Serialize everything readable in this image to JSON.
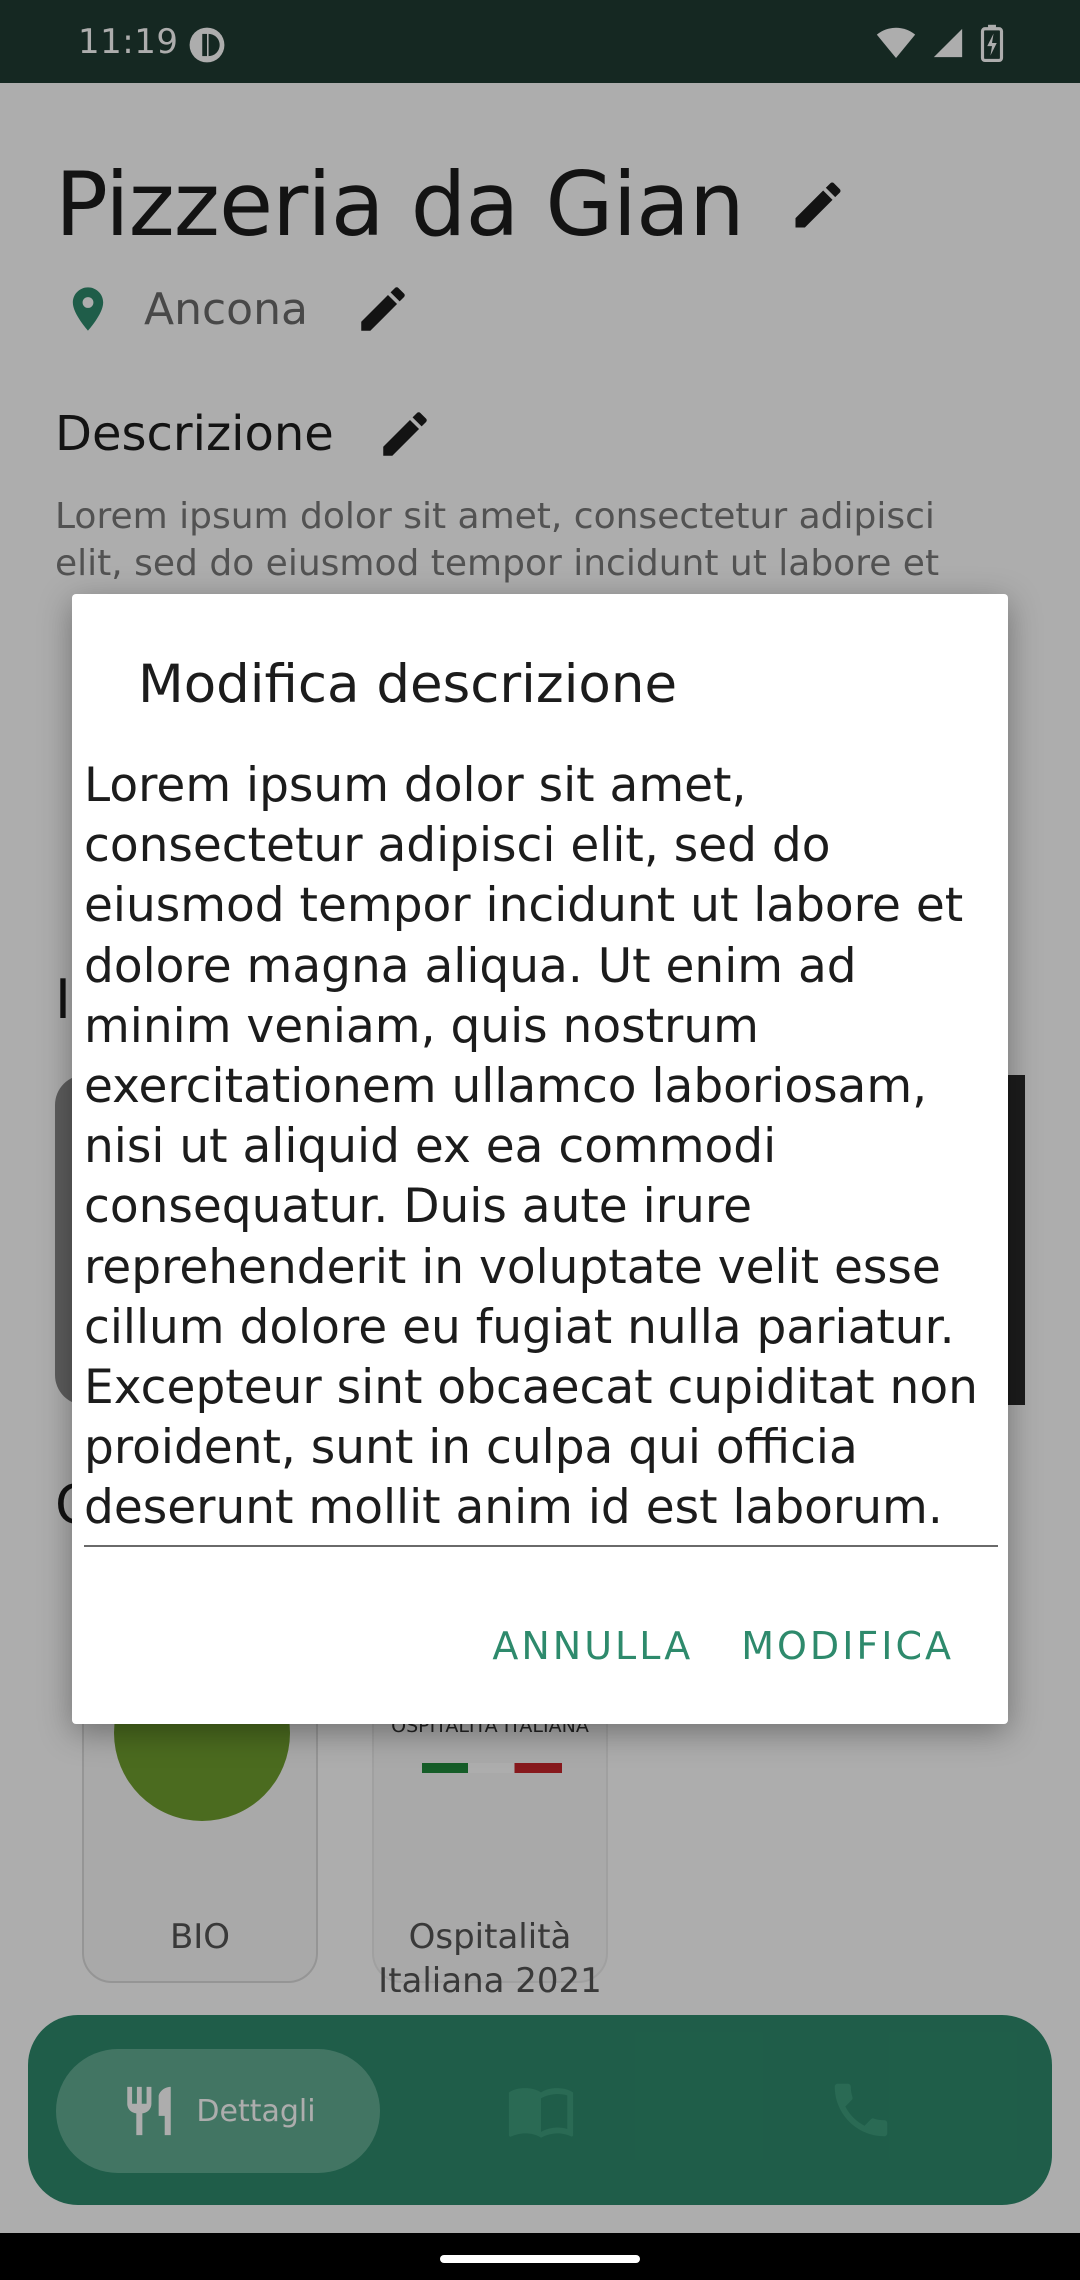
{
  "status_bar": {
    "time": "11:19",
    "app_icon": "app-badge-icon",
    "icons": [
      "wifi-icon",
      "signal-icon",
      "battery-charging-icon"
    ]
  },
  "page": {
    "title": "Pizzeria da Gian",
    "location": "Ancona",
    "description_heading": "Descrizione",
    "description_preview": "Lorem ipsum dolor sit amet, consectetur adipisci elit, sed do eiusmod tempor incidunt ut labore et",
    "certifications": [
      {
        "label": "BIO"
      },
      {
        "label": "Ospitalità Italiana 2021"
      }
    ]
  },
  "bottom_nav": {
    "active_label": "Dettagli",
    "items": [
      "restaurant-icon",
      "menu-book-icon",
      "phone-icon"
    ]
  },
  "dialog": {
    "title": "Modifica descrizione",
    "text": "Lorem ipsum dolor sit amet, consectetur adipisci elit, sed do eiusmod tempor incidunt ut labore et dolore magna aliqua. Ut enim ad minim veniam, quis nostrum exercitationem ullamco laboriosam, nisi ut aliquid ex ea commodi consequatur. Duis aute irure reprehenderit in voluptate velit esse cillum dolore eu fugiat nulla pariatur. Excepteur sint obcaecat cupiditat non proident, sunt in culpa qui officia deserunt mollit anim id est laborum.",
    "cancel_label": "ANNULLA",
    "confirm_label": "MODIFICA"
  },
  "colors": {
    "status_bar": "#1f3b33",
    "accent": "#2e8a6c",
    "scrim": "rgba(0,0,0,0.32)"
  }
}
